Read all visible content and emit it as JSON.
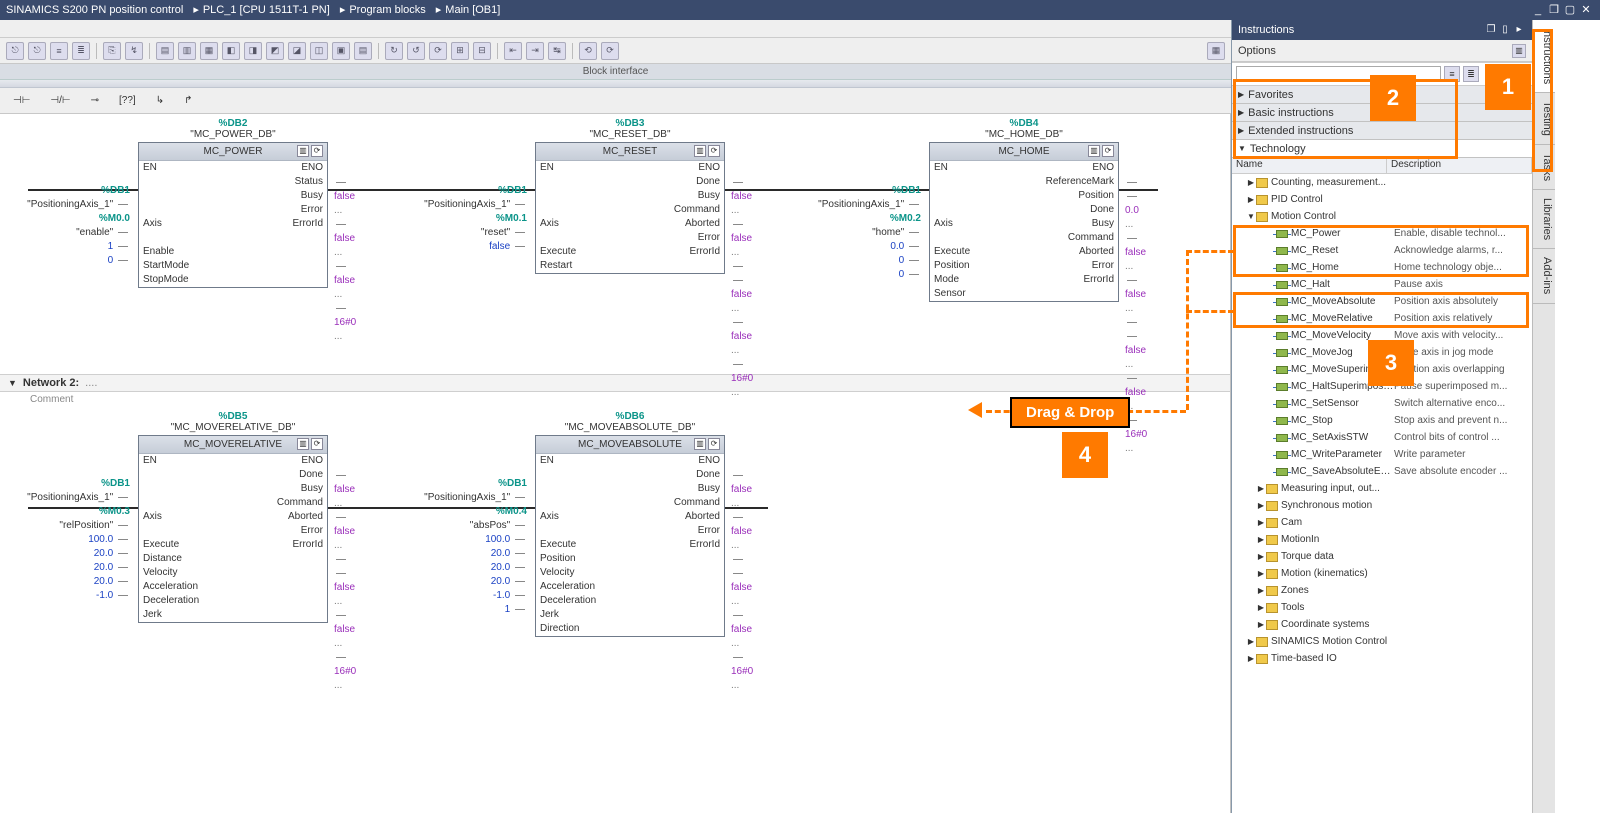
{
  "titlebar": {
    "crumbs": [
      "SINAMICS S200 PN position control",
      "PLC_1 [CPU 1511T-1 PN]",
      "Program blocks",
      "Main [OB1]"
    ]
  },
  "blockInterface": "Block interface",
  "instructionsPanel": {
    "title": "Instructions",
    "options": "Options",
    "sections": {
      "favorites": "Favorites",
      "basic": "Basic instructions",
      "extended": "Extended instructions",
      "technology": "Technology"
    },
    "cols": {
      "name": "Name",
      "desc": "Description"
    },
    "tree": [
      {
        "t": "folder",
        "ind": 1,
        "exp": "▶",
        "name": "Counting, measurement...",
        "desc": ""
      },
      {
        "t": "folder",
        "ind": 1,
        "exp": "▶",
        "name": "PID Control",
        "desc": ""
      },
      {
        "t": "folder",
        "ind": 1,
        "exp": "▼",
        "name": "Motion Control",
        "desc": ""
      },
      {
        "t": "block",
        "ind": 3,
        "name": "MC_Power",
        "desc": "Enable, disable technol..."
      },
      {
        "t": "block",
        "ind": 3,
        "name": "MC_Reset",
        "desc": "Acknowledge alarms, r..."
      },
      {
        "t": "block",
        "ind": 3,
        "name": "MC_Home",
        "desc": "Home technology obje..."
      },
      {
        "t": "block",
        "ind": 3,
        "name": "MC_Halt",
        "desc": "Pause axis"
      },
      {
        "t": "block",
        "ind": 3,
        "name": "MC_MoveAbsolute",
        "desc": "Position axis absolutely"
      },
      {
        "t": "block",
        "ind": 3,
        "name": "MC_MoveRelative",
        "desc": "Position axis relatively"
      },
      {
        "t": "block",
        "ind": 3,
        "name": "MC_MoveVelocity",
        "desc": "Move axis with velocity..."
      },
      {
        "t": "block",
        "ind": 3,
        "name": "MC_MoveJog",
        "desc": "Move axis in jog mode"
      },
      {
        "t": "block",
        "ind": 3,
        "name": "MC_MoveSuperimposed",
        "desc": "Position axis overlapping"
      },
      {
        "t": "block",
        "ind": 3,
        "name": "MC_HaltSuperimposed",
        "desc": "Pause superimposed m..."
      },
      {
        "t": "block",
        "ind": 3,
        "name": "MC_SetSensor",
        "desc": "Switch alternative enco..."
      },
      {
        "t": "block",
        "ind": 3,
        "name": "MC_Stop",
        "desc": "Stop axis and prevent n..."
      },
      {
        "t": "block",
        "ind": 3,
        "name": "MC_SetAxisSTW",
        "desc": "Control bits of control ..."
      },
      {
        "t": "block",
        "ind": 3,
        "name": "MC_WriteParameter",
        "desc": "Write parameter"
      },
      {
        "t": "block",
        "ind": 3,
        "name": "MC_SaveAbsoluteEnc...",
        "desc": "Save absolute encoder ..."
      },
      {
        "t": "folder",
        "ind": 2,
        "exp": "▶",
        "name": "Measuring input, out...",
        "desc": ""
      },
      {
        "t": "folder",
        "ind": 2,
        "exp": "▶",
        "name": "Synchronous motion",
        "desc": ""
      },
      {
        "t": "folder",
        "ind": 2,
        "exp": "▶",
        "name": "Cam",
        "desc": ""
      },
      {
        "t": "folder",
        "ind": 2,
        "exp": "▶",
        "name": "MotionIn",
        "desc": ""
      },
      {
        "t": "folder",
        "ind": 2,
        "exp": "▶",
        "name": "Torque data",
        "desc": ""
      },
      {
        "t": "folder",
        "ind": 2,
        "exp": "▶",
        "name": "Motion (kinematics)",
        "desc": ""
      },
      {
        "t": "folder",
        "ind": 2,
        "exp": "▶",
        "name": "Zones",
        "desc": ""
      },
      {
        "t": "folder",
        "ind": 2,
        "exp": "▶",
        "name": "Tools",
        "desc": ""
      },
      {
        "t": "folder",
        "ind": 2,
        "exp": "▶",
        "name": "Coordinate systems",
        "desc": ""
      },
      {
        "t": "folder",
        "ind": 1,
        "exp": "▶",
        "name": "SINAMICS Motion Control",
        "desc": ""
      },
      {
        "t": "folder",
        "ind": 1,
        "exp": "▶",
        "name": "Time-based IO",
        "desc": ""
      }
    ]
  },
  "sidetabs": [
    "Instructions",
    "Testing",
    "Tasks",
    "Libraries",
    "Add-ins"
  ],
  "net2": {
    "title": "Network 2:",
    "comment": "Comment"
  },
  "callouts": {
    "drag": "Drag & Drop",
    "n1": "1",
    "n2": "2",
    "n3": "3",
    "n4": "4"
  },
  "blocks": {
    "power": {
      "db": "%DB2",
      "dbn": "\"MC_POWER_DB\"",
      "title": "MC_POWER",
      "leftSignals": [
        {
          "s": "%DB1",
          "n": "\"PositioningAxis_1\"",
          "port": "Axis"
        },
        {
          "s": "%M0.0",
          "n": "\"enable\"",
          "port": "Enable"
        },
        {
          "v": "1",
          "port": "StartMode"
        },
        {
          "v": "0",
          "port": "StopMode"
        }
      ],
      "ios": [
        [
          "EN",
          "ENO"
        ],
        [
          "",
          "Status"
        ],
        [
          "",
          "Busy"
        ],
        [
          "",
          "Error"
        ],
        [
          "Axis",
          "ErrorId"
        ],
        [
          "",
          ""
        ],
        [
          "Enable",
          ""
        ],
        [
          "StartMode",
          ""
        ],
        [
          "StopMode",
          ""
        ]
      ],
      "outs": [
        [
          "false",
          ""
        ],
        [
          "false",
          ""
        ],
        [
          "false",
          ""
        ],
        [
          "16#0",
          ""
        ]
      ]
    },
    "reset": {
      "db": "%DB3",
      "dbn": "\"MC_RESET_DB\"",
      "title": "MC_RESET",
      "leftSignals": [
        {
          "s": "%DB1",
          "n": "\"PositioningAxis_1\"",
          "port": "Axis"
        },
        {
          "s": "%M0.1",
          "n": "\"reset\"",
          "port": "Execute"
        },
        {
          "v": "false",
          "port": "Restart"
        }
      ],
      "ios": [
        [
          "EN",
          "ENO"
        ],
        [
          "",
          "Done"
        ],
        [
          "",
          "Busy"
        ],
        [
          "",
          "Command"
        ],
        [
          "Axis",
          "Aborted"
        ],
        [
          "",
          "Error"
        ],
        [
          "Execute",
          "ErrorId"
        ],
        [
          "Restart",
          ""
        ]
      ],
      "outs": [
        [
          "false",
          ""
        ],
        [
          "false",
          ""
        ],
        [
          "",
          ""
        ],
        [
          "false",
          ""
        ],
        [
          "false",
          ""
        ],
        [
          "16#0",
          ""
        ]
      ]
    },
    "home": {
      "db": "%DB4",
      "dbn": "\"MC_HOME_DB\"",
      "title": "MC_HOME",
      "leftSignals": [
        {
          "s": "%DB1",
          "n": "\"PositioningAxis_1\"",
          "port": "Axis"
        },
        {
          "s": "%M0.2",
          "n": "\"home\"",
          "port": "Execute"
        },
        {
          "v": "0.0",
          "port": "Position"
        },
        {
          "v": "0",
          "port": "Mode"
        },
        {
          "v": "0",
          "port": "Sensor"
        }
      ],
      "ios": [
        [
          "EN",
          "ENO"
        ],
        [
          "",
          "ReferenceMark"
        ],
        [
          "",
          "Position"
        ],
        [
          "",
          "Done"
        ],
        [
          "Axis",
          "Busy"
        ],
        [
          "",
          "Command"
        ],
        [
          "Execute",
          "Aborted"
        ],
        [
          "Position",
          "Error"
        ],
        [
          "Mode",
          "ErrorId"
        ],
        [
          "Sensor",
          ""
        ]
      ],
      "outs": [
        [
          "",
          ""
        ],
        [
          "0.0",
          ""
        ],
        [
          "false",
          ""
        ],
        [
          "false",
          ""
        ],
        [
          "",
          ""
        ],
        [
          "false",
          ""
        ],
        [
          "false",
          ""
        ],
        [
          "16#0",
          ""
        ]
      ]
    },
    "moverel": {
      "db": "%DB5",
      "dbn": "\"MC_MOVERELATIVE_DB\"",
      "title": "MC_MOVERELATIVE",
      "leftSignals": [
        {
          "s": "%DB1",
          "n": "\"PositioningAxis_1\"",
          "port": "Axis"
        },
        {
          "s": "%M0.3",
          "n": "\"relPosition\"",
          "port": "Execute"
        },
        {
          "v": "100.0",
          "port": "Distance"
        },
        {
          "v": "20.0",
          "port": "Velocity"
        },
        {
          "v": "20.0",
          "port": "Acceleration"
        },
        {
          "v": "20.0",
          "port": "Deceleration"
        },
        {
          "v": "-1.0",
          "port": "Jerk"
        }
      ],
      "ios": [
        [
          "EN",
          "ENO"
        ],
        [
          "",
          "Done"
        ],
        [
          "",
          "Busy"
        ],
        [
          "",
          "Command"
        ],
        [
          "Axis",
          "Aborted"
        ],
        [
          "",
          "Error"
        ],
        [
          "Execute",
          "ErrorId"
        ],
        [
          "Distance",
          ""
        ],
        [
          "Velocity",
          ""
        ],
        [
          "Acceleration",
          ""
        ],
        [
          "Deceleration",
          ""
        ],
        [
          "Jerk",
          ""
        ]
      ],
      "outs": [
        [
          "false",
          ""
        ],
        [
          "false",
          ""
        ],
        [
          "",
          ""
        ],
        [
          "false",
          ""
        ],
        [
          "false",
          ""
        ],
        [
          "16#0",
          ""
        ]
      ]
    },
    "moveabs": {
      "db": "%DB6",
      "dbn": "\"MC_MOVEABSOLUTE_DB\"",
      "title": "MC_MOVEABSOLUTE",
      "leftSignals": [
        {
          "s": "%DB1",
          "n": "\"PositioningAxis_1\"",
          "port": "Axis"
        },
        {
          "s": "%M0.4",
          "n": "\"absPos\"",
          "port": "Execute"
        },
        {
          "v": "100.0",
          "port": "Position"
        },
        {
          "v": "20.0",
          "port": "Velocity"
        },
        {
          "v": "20.0",
          "port": "Acceleration"
        },
        {
          "v": "20.0",
          "port": "Deceleration"
        },
        {
          "v": "-1.0",
          "port": "Jerk"
        },
        {
          "v": "1",
          "port": "Direction"
        }
      ],
      "ios": [
        [
          "EN",
          "ENO"
        ],
        [
          "",
          "Done"
        ],
        [
          "",
          "Busy"
        ],
        [
          "",
          "Command"
        ],
        [
          "Axis",
          "Aborted"
        ],
        [
          "",
          "Error"
        ],
        [
          "Execute",
          "ErrorId"
        ],
        [
          "Position",
          ""
        ],
        [
          "Velocity",
          ""
        ],
        [
          "Acceleration",
          ""
        ],
        [
          "Deceleration",
          ""
        ],
        [
          "Jerk",
          ""
        ],
        [
          "Direction",
          ""
        ]
      ],
      "outs": [
        [
          "false",
          ""
        ],
        [
          "false",
          ""
        ],
        [
          "",
          ""
        ],
        [
          "false",
          ""
        ],
        [
          "false",
          ""
        ],
        [
          "16#0",
          ""
        ]
      ]
    }
  }
}
